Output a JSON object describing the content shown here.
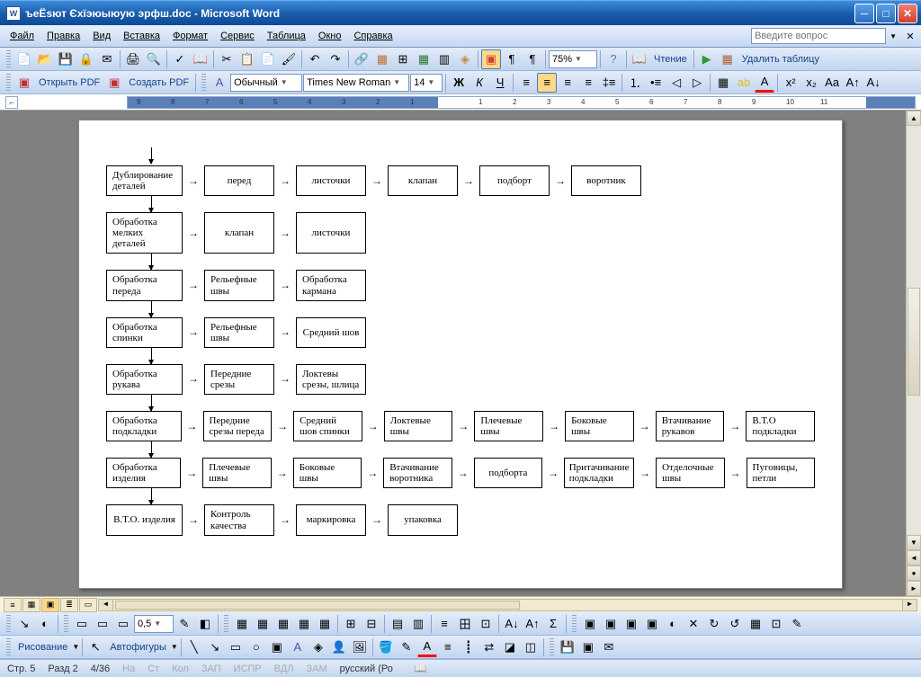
{
  "window": {
    "title": "ъеЁѕют Єхїэюыюую эрфш.doc - Microsoft Word"
  },
  "menu": {
    "items": [
      "Файл",
      "Правка",
      "Вид",
      "Вставка",
      "Формат",
      "Сервис",
      "Таблица",
      "Окно",
      "Справка"
    ],
    "askbox": "Введите вопрос"
  },
  "toolbar1": {
    "zoom": "75%",
    "reading": "Чтение",
    "del_table": "Удалить таблицу"
  },
  "pdf": {
    "open": "Открыть PDF",
    "create": "Создать PDF"
  },
  "format": {
    "style": "Обычный",
    "font": "Times New Roman",
    "size": "14"
  },
  "ruler_nums": [
    "9",
    "8",
    "7",
    "6",
    "5",
    "4",
    "3",
    "2",
    "1",
    "",
    "1",
    "2",
    "3",
    "4",
    "5",
    "6",
    "7",
    "8",
    "9",
    "10",
    "11"
  ],
  "flow": {
    "rows": [
      {
        "boxes": [
          "Дублирование деталей",
          "перед",
          "листочки",
          "клапан",
          "подборт",
          "воротник"
        ]
      },
      {
        "boxes": [
          "Обработка мелких деталей",
          "клапан",
          "листочки"
        ]
      },
      {
        "boxes": [
          "Обработка переда",
          "Рельефные швы",
          "Обработка кармана"
        ]
      },
      {
        "boxes": [
          "Обработка спинки",
          "Рельефные швы",
          "Средний шов"
        ]
      },
      {
        "boxes": [
          "Обработка рукава",
          "Передние срезы",
          "Локтевы срезы, шлица"
        ]
      },
      {
        "boxes": [
          "Обработка подкладки",
          "Передние срезы переда",
          "Средний шов спинки",
          "Локтевые швы",
          "Плечевые швы",
          "Боковые швы",
          "Втачивание рукавов",
          "В.Т.О подкладки"
        ]
      },
      {
        "boxes": [
          "Обработка изделия",
          "Плечевые швы",
          "Боковые швы",
          "Втачивание воротника",
          "подборта",
          "Притачивание подкладки",
          "Отделочные швы",
          "Пуговицы, петли"
        ]
      },
      {
        "boxes": [
          "В.Т.О. изделия",
          "Контроль качества",
          "маркировка",
          "упаковка"
        ]
      }
    ]
  },
  "drawing": {
    "label": "Рисование",
    "autoshapes": "Автофигуры",
    "linewidth": "0,5"
  },
  "status": {
    "page": "Стр. 5",
    "sec": "Разд 2",
    "pages": "4/36",
    "at": "На",
    "ln": "Ст",
    "col": "Кол",
    "zap": "ЗАП",
    "ispr": "ИСПР",
    "vdl": "ВДЛ",
    "zam": "ЗАМ",
    "lang": "русский (Ро"
  }
}
